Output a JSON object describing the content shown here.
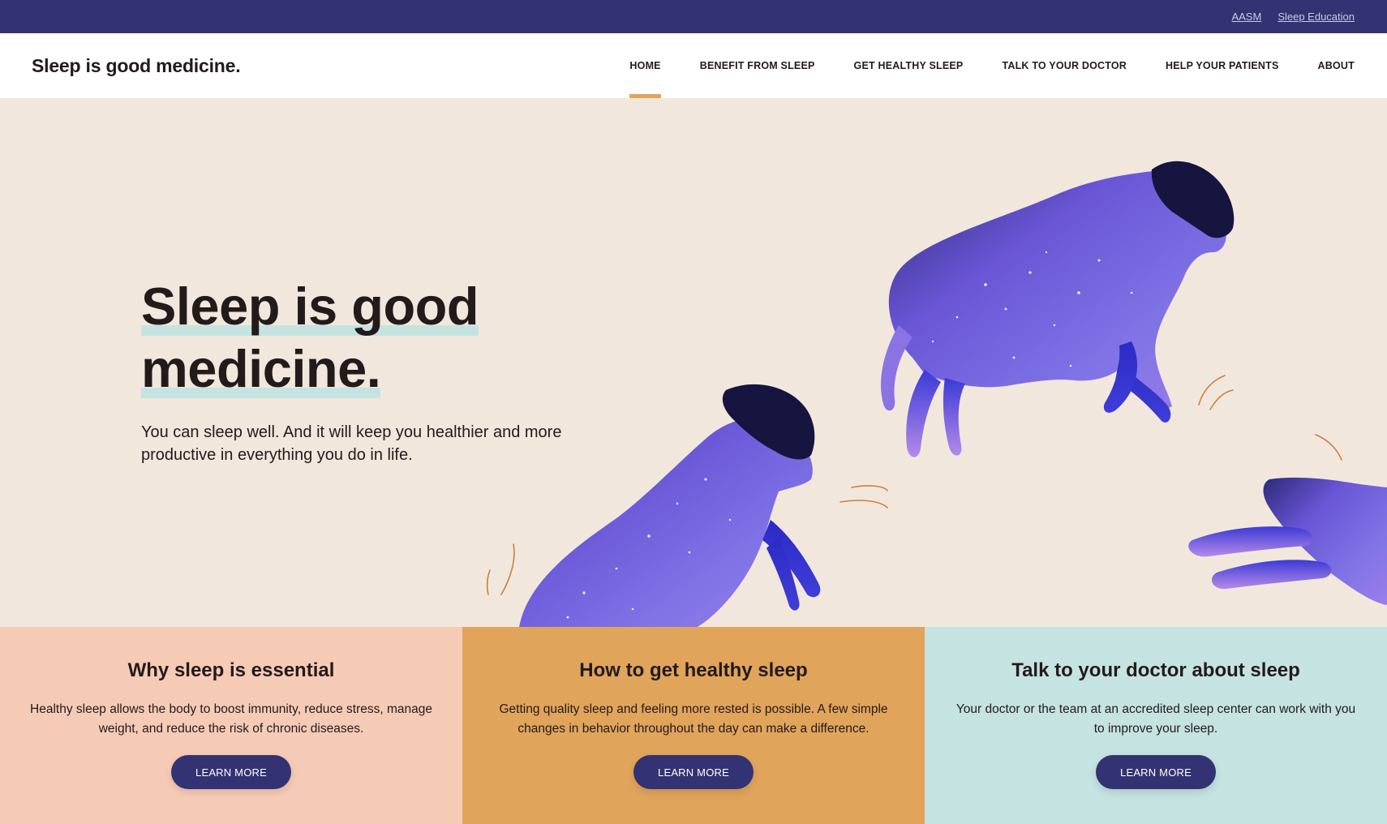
{
  "utility": {
    "links": [
      "AASM",
      "Sleep Education"
    ]
  },
  "nav": {
    "site_title": "Sleep is good medicine.",
    "items": [
      "HOME",
      "BENEFIT FROM SLEEP",
      "GET HEALTHY SLEEP",
      "TALK TO YOUR DOCTOR",
      "HELP YOUR PATIENTS",
      "ABOUT"
    ],
    "active": "HOME"
  },
  "hero": {
    "heading_line1": "Sleep is good",
    "heading_line2": "medicine.",
    "subtitle": "You can sleep well. And it will keep you healthier and more productive in everything you do in life."
  },
  "cards": [
    {
      "title": "Why sleep is essential",
      "text": "Healthy sleep allows the body to boost immunity, reduce stress, manage weight, and reduce the risk of chronic diseases.",
      "button": "LEARN MORE"
    },
    {
      "title": "How to get healthy sleep",
      "text": "Getting quality sleep and feeling more rested is possible. A few simple changes in behavior throughout the day can make a difference.",
      "button": "LEARN MORE"
    },
    {
      "title": "Talk to your doctor about sleep",
      "text": "Your doctor or the team at an accredited sleep center can work with you to improve your sleep.",
      "button": "LEARN MORE"
    }
  ],
  "colors": {
    "utility_bar": "#333373",
    "hero_bg": "#f2e7dc",
    "accent_orange": "#e1a45b",
    "card_peach": "#f6cbb6",
    "card_teal": "#c5e3e1",
    "button": "#333373"
  }
}
